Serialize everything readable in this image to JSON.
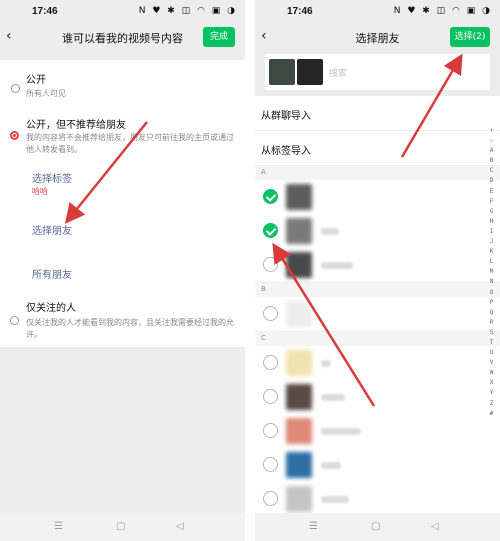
{
  "left": {
    "status": {
      "time": "17:46",
      "icons": "N ♥ ✱ ◫ ◠ ▣ ◑"
    },
    "nav": {
      "title": "谁可以看我的视频号内容",
      "done": "完成"
    },
    "options": [
      {
        "title": "公开",
        "sub": "所有人可见"
      },
      {
        "title": "公开，但不推荐给朋友",
        "sub": "我的内容将不会推荐给朋友，朋友只可前往我的主页或通过他人转发看到。"
      },
      {
        "title": "仅关注的人",
        "sub": "仅关注我的人才能看到我的内容，且关注我需要经过我的允许。"
      }
    ],
    "links": {
      "select_tag": "选择标签",
      "tag_name": "哈哈",
      "select_friends": "选择朋友",
      "all_friends": "所有朋友"
    }
  },
  "right": {
    "status": {
      "time": "17:46",
      "icons": "N ♥ ✱ ◫ ◠ ▣ ◑"
    },
    "nav": {
      "title": "选择朋友",
      "select": "选择(2)"
    },
    "search_placeholder": "搜索",
    "import_group": "从群聊导入",
    "import_tag": "从标签导入",
    "sections": [
      "A",
      "B",
      "C"
    ],
    "friends": [
      {
        "checked": true,
        "color": "#5c5c5c"
      },
      {
        "checked": true,
        "color": "#7a7a7a"
      },
      {
        "checked": false,
        "color": "#4a4a4a"
      },
      {
        "checked": false,
        "color": "#eeeeee"
      },
      {
        "checked": false,
        "color": "#f3e3b0"
      },
      {
        "checked": false,
        "color": "#5a4a44"
      },
      {
        "checked": false,
        "color": "#e0887a"
      },
      {
        "checked": false,
        "color": "#2e6fa6"
      },
      {
        "checked": false,
        "color": "#c4c4c4"
      }
    ],
    "alphabet": [
      "↑",
      "☆",
      "A",
      "B",
      "C",
      "D",
      "E",
      "F",
      "G",
      "H",
      "I",
      "J",
      "K",
      "L",
      "M",
      "N",
      "O",
      "P",
      "Q",
      "R",
      "S",
      "T",
      "U",
      "V",
      "W",
      "X",
      "Y",
      "Z",
      "#"
    ]
  },
  "sysnav": {
    "menu_icon": "☰",
    "home_icon": "▢",
    "back_icon": "◁"
  },
  "colors": {
    "accent_green": "#07c160",
    "annotation_red": "#d93a3a",
    "link_blue": "#576b95"
  }
}
